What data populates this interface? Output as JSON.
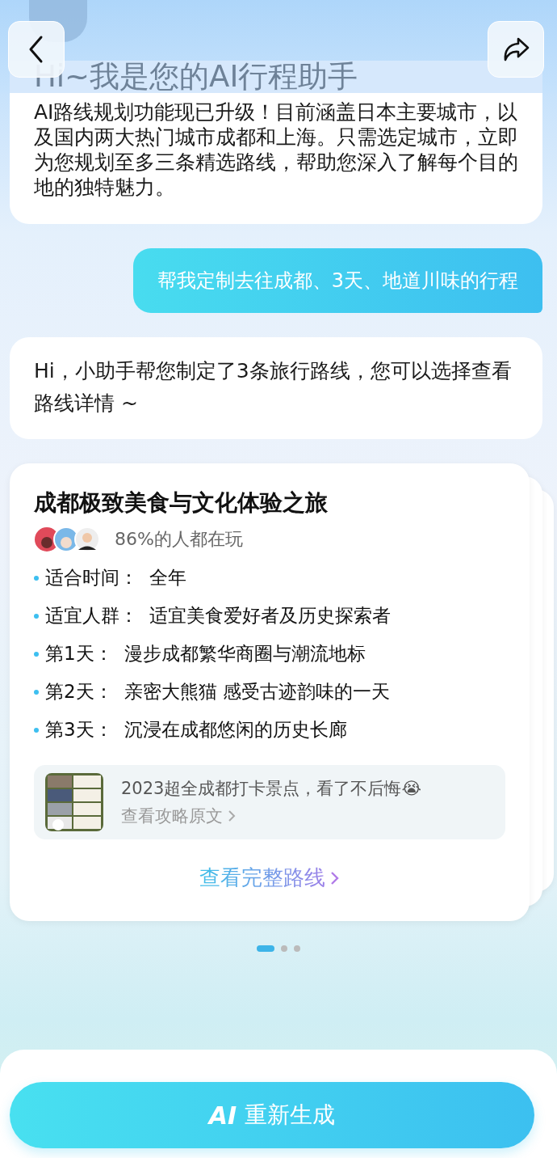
{
  "header": {
    "title": "Hi~我是您的AI行程助手"
  },
  "intro": {
    "text": "AI路线规划功能现已升级！目前涵盖日本主要城市，以及国内两大热门城市成都和上海。只需选定城市，立即为您规划至多三条精选路线，帮助您深入了解每个目的地的独特魅力。"
  },
  "user_message": {
    "text": "帮我定制去往成都、3天、地道川味的行程"
  },
  "reply": {
    "text": "Hi，小助手帮您制定了3条旅行路线，您可以选择查看路线详情 ~"
  },
  "route_card": {
    "title": "成都极致美食与文化体验之旅",
    "popularity": "86%的人都在玩",
    "details": [
      {
        "label": "适合时间：",
        "value": "全年"
      },
      {
        "label": "适宜人群：",
        "value": "适宜美食爱好者及历史探索者"
      },
      {
        "label": "第1天：",
        "value": "漫步成都繁华商圈与潮流地标"
      },
      {
        "label": "第2天：",
        "value": "亲密大熊猫 感受古迹韵味的一天"
      },
      {
        "label": "第3天：",
        "value": "沉浸在成都悠闲的历史长廊"
      }
    ],
    "article": {
      "title": "2023超全成都打卡景点，看了不后悔😭",
      "link": "查看攻略原文"
    },
    "full_route_link": "查看完整路线"
  },
  "pagination": [
    {
      "selected": true
    },
    {
      "selected": false
    },
    {
      "selected": false
    }
  ],
  "regenerate_button": {
    "logo": "AI",
    "label": "重新生成"
  }
}
